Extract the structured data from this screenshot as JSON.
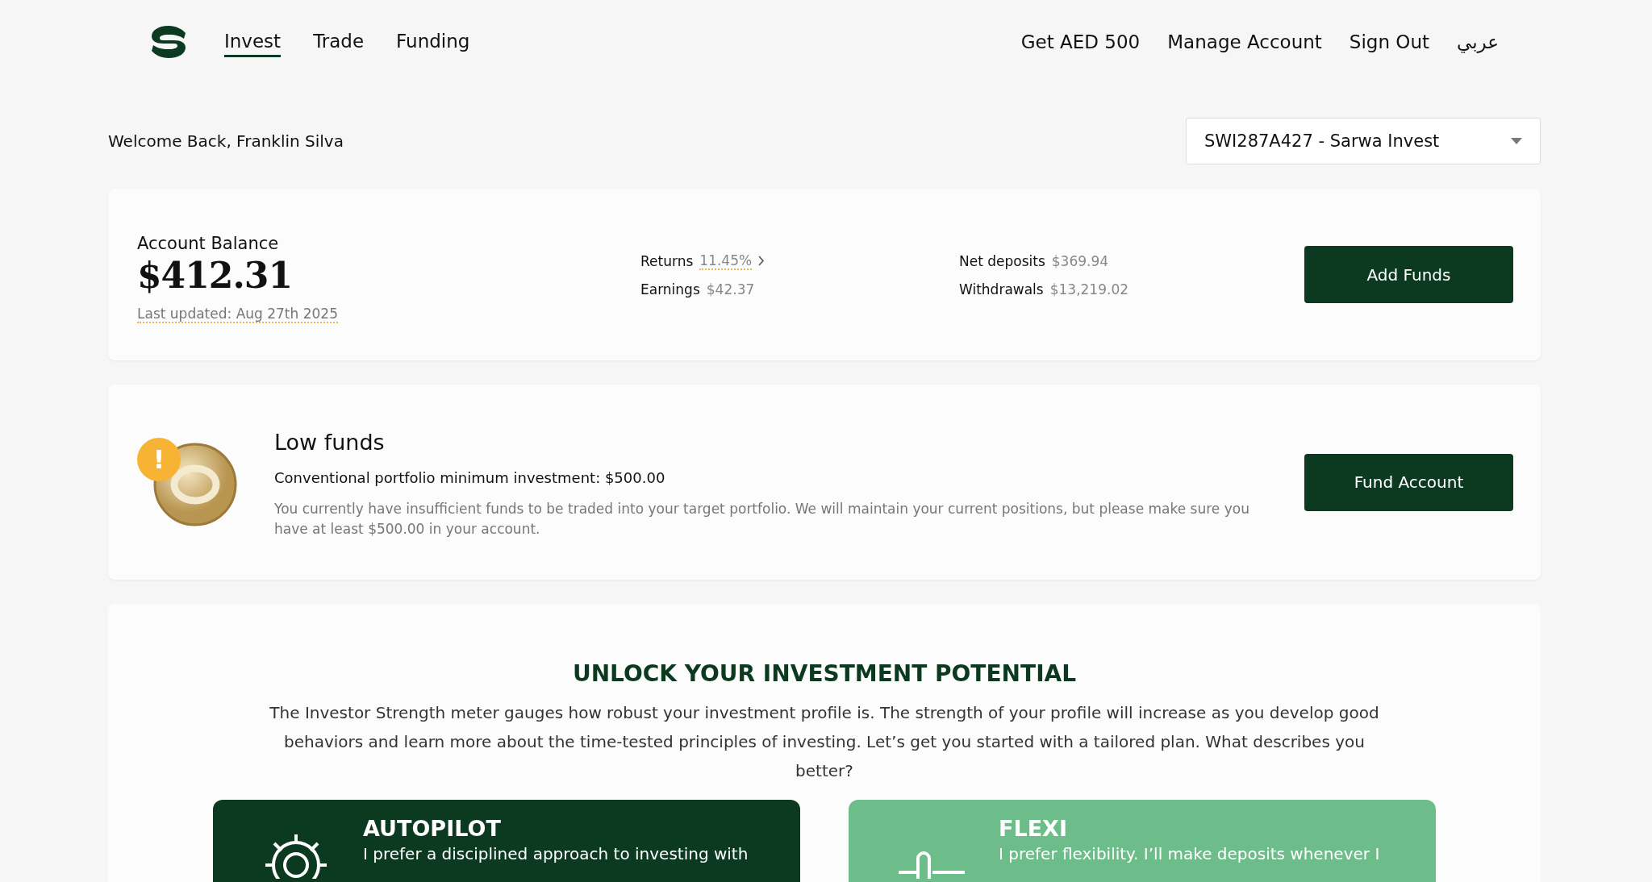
{
  "nav": {
    "links": [
      {
        "label": "Invest",
        "selected": true
      },
      {
        "label": "Trade",
        "selected": false
      },
      {
        "label": "Funding",
        "selected": false
      }
    ],
    "right_links": [
      "Get AED 500",
      "Manage Account",
      "Sign Out",
      "عربي"
    ]
  },
  "welcome": "Welcome Back, Franklin Silva",
  "account_select": {
    "value": "SWI287A427 - Sarwa Invest"
  },
  "balance_card": {
    "title": "Account Balance",
    "amount": "$412.31",
    "updated": "Last updated: Aug 27th 2025",
    "stats": [
      {
        "label": "Returns",
        "value": "11.45%",
        "link": true
      },
      {
        "label": "Earnings",
        "value": "$42.37",
        "link": false
      },
      {
        "label": "Net deposits",
        "value": "$369.94",
        "link": false
      },
      {
        "label": "Withdrawals",
        "value": "$13,219.02",
        "link": false
      }
    ],
    "button": "Add Funds"
  },
  "alert_card": {
    "badge": "!",
    "title": "Low funds",
    "subtitle": "Conventional portfolio minimum investment: $500.00",
    "body": "You currently have insufficient funds to be traded into your target portfolio. We will maintain your current positions, but please make sure you have at least $500.00 in your account.",
    "button": "Fund Account"
  },
  "potential": {
    "heading": "UNLOCK YOUR INVESTMENT POTENTIAL",
    "body": "The Investor Strength meter gauges how robust your investment profile is. The strength of your profile will increase as you develop good behaviors and learn more about the time-tested principles of investing. Let’s get you started with a tailored plan. What describes you better?",
    "plans": [
      {
        "kind": "autopilot",
        "title": "AUTOPILOT",
        "text": "I prefer a disciplined approach to investing with"
      },
      {
        "kind": "flexi",
        "title": "FLEXI",
        "text": "I prefer flexibility. I’ll make deposits whenever I"
      }
    ]
  }
}
